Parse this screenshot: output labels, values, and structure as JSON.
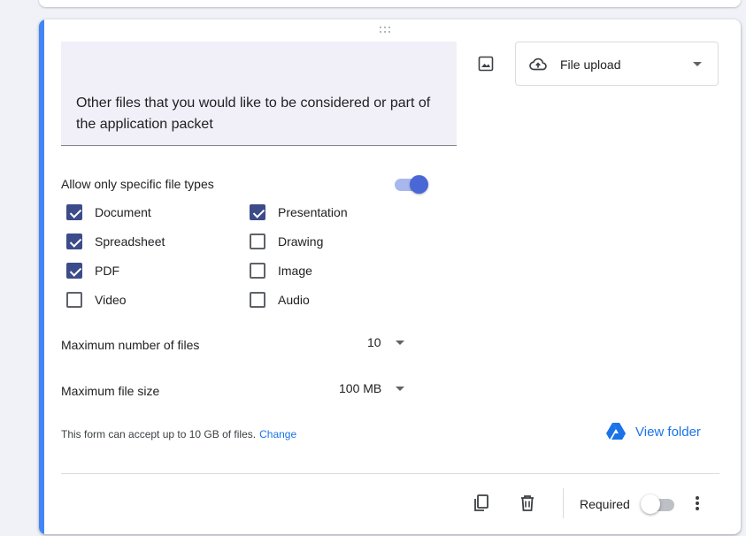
{
  "question": {
    "title": "Other files that you would like to be considered or part of the application packet",
    "type_label": "File upload"
  },
  "settings": {
    "allow_specific_types_label": "Allow only specific file types",
    "allow_specific_types_on": true,
    "file_types": [
      {
        "label": "Document",
        "checked": true
      },
      {
        "label": "Presentation",
        "checked": true
      },
      {
        "label": "Spreadsheet",
        "checked": true
      },
      {
        "label": "Drawing",
        "checked": false
      },
      {
        "label": "PDF",
        "checked": true
      },
      {
        "label": "Image",
        "checked": false
      },
      {
        "label": "Video",
        "checked": false
      },
      {
        "label": "Audio",
        "checked": false
      }
    ],
    "max_files_label": "Maximum number of files",
    "max_files_value": "10",
    "max_size_label": "Maximum file size",
    "max_size_value": "100 MB",
    "limit_text": "This form can accept up to 10 GB of files.",
    "change_link": "Change",
    "view_folder_label": "View folder"
  },
  "footer": {
    "required_label": "Required",
    "required_on": false
  },
  "icons": {
    "image": "image-icon",
    "upload": "cloud-upload-icon",
    "drive": "google-drive-icon",
    "copy": "copy-icon",
    "delete": "trash-icon",
    "more": "more-vert-icon"
  },
  "colors": {
    "accent": "#4285f4",
    "checkbox_checked": "#3c4b8a",
    "toggle_on": "#4a67d6",
    "link": "#1a73e8"
  }
}
